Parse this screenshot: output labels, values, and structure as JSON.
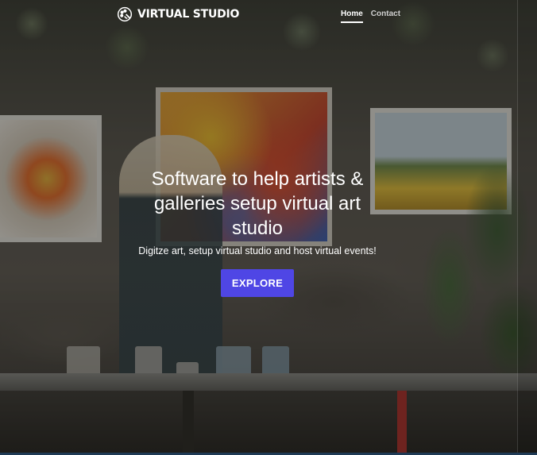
{
  "brand": {
    "name": "VIRTUAL STUDIO",
    "icon": "palette-icon"
  },
  "nav": {
    "items": [
      {
        "label": "Home",
        "active": true
      },
      {
        "label": "Contact",
        "active": false
      }
    ]
  },
  "hero": {
    "title": "Software to help artists & galleries setup virtual art studio",
    "subtitle": "Digitze art, setup virtual studio and host virtual events!",
    "cta_label": "EXPLORE"
  },
  "colors": {
    "accent": "#4f46e5",
    "text": "#ffffff"
  }
}
